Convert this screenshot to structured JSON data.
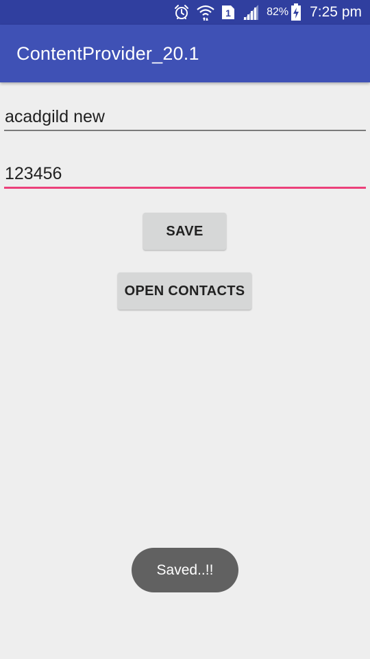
{
  "status_bar": {
    "icons": [
      "alarm-icon",
      "wifi-icon",
      "sim-1-icon",
      "signal-icon",
      "battery-charging-icon"
    ],
    "sim_label": "1",
    "battery_percent": "82%",
    "time": "7:25 pm"
  },
  "app_bar": {
    "title": "ContentProvider_20.1"
  },
  "form": {
    "name_value": "acadgild new",
    "phone_value": "123456",
    "save_label": "SAVE",
    "open_contacts_label": "OPEN CONTACTS"
  },
  "toast": {
    "message": "Saved..!!"
  },
  "colors": {
    "status_bar": "#303f9f",
    "app_bar": "#3f51b5",
    "accent": "#ec407a",
    "background": "#eeeeee",
    "button": "#d6d7d7",
    "toast": "#616161"
  }
}
